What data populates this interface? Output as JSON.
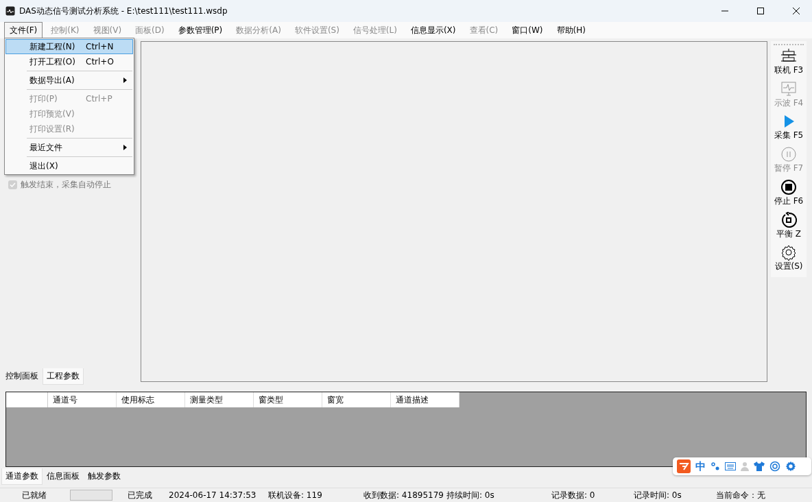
{
  "window": {
    "title": "DAS动态信号测试分析系统 - E:\\test111\\test111.wsdp"
  },
  "menu_bar": [
    {
      "label": "文件(F)",
      "disabled": false,
      "selected": true
    },
    {
      "label": "控制(K)",
      "disabled": true,
      "selected": false
    },
    {
      "label": "视图(V)",
      "disabled": true,
      "selected": false
    },
    {
      "label": "面板(D)",
      "disabled": true,
      "selected": false
    },
    {
      "label": "参数管理(P)",
      "disabled": false,
      "selected": false
    },
    {
      "label": "数据分析(A)",
      "disabled": true,
      "selected": false
    },
    {
      "label": "软件设置(S)",
      "disabled": true,
      "selected": false
    },
    {
      "label": "信号处理(L)",
      "disabled": true,
      "selected": false
    },
    {
      "label": "信息显示(X)",
      "disabled": false,
      "selected": false
    },
    {
      "label": "查看(C)",
      "disabled": true,
      "selected": false
    },
    {
      "label": "窗口(W)",
      "disabled": false,
      "selected": false
    },
    {
      "label": "帮助(H)",
      "disabled": false,
      "selected": false
    }
  ],
  "file_menu": [
    {
      "kind": "item",
      "label": "新建工程(N)",
      "shortcut": "Ctrl+N",
      "disabled": false,
      "selected": true
    },
    {
      "kind": "item",
      "label": "打开工程(O)",
      "shortcut": "Ctrl+O",
      "disabled": false,
      "selected": false
    },
    {
      "kind": "separator"
    },
    {
      "kind": "submenu",
      "label": "数据导出(A)",
      "disabled": false,
      "selected": false
    },
    {
      "kind": "separator"
    },
    {
      "kind": "item",
      "label": "打印(P)",
      "shortcut": "Ctrl+P",
      "disabled": true,
      "selected": false
    },
    {
      "kind": "item",
      "label": "打印预览(V)",
      "disabled": true,
      "selected": false
    },
    {
      "kind": "item",
      "label": "打印设置(R)",
      "disabled": true,
      "selected": false
    },
    {
      "kind": "separator"
    },
    {
      "kind": "submenu",
      "label": "最近文件",
      "disabled": false,
      "selected": false
    },
    {
      "kind": "separator"
    },
    {
      "kind": "item",
      "label": "退出(X)",
      "disabled": false,
      "selected": false
    }
  ],
  "left_panel": {
    "checkbox": {
      "label": "触发结束，采集自动停止",
      "checked": true,
      "disabled": true
    },
    "tabs": [
      {
        "label": "控制面板",
        "selected": false
      },
      {
        "label": "工程参数",
        "selected": true
      }
    ]
  },
  "right_toolbar": [
    {
      "kind": "connect",
      "label": "联机 F3",
      "disabled": false
    },
    {
      "kind": "scope",
      "label": "示波 F4",
      "disabled": true
    },
    {
      "kind": "play",
      "label": "采集 F5",
      "disabled": false
    },
    {
      "kind": "pause",
      "label": "暂停 F7",
      "disabled": true
    },
    {
      "kind": "stop",
      "label": "停止 F6",
      "disabled": false
    },
    {
      "kind": "balance",
      "label": "平衡 Z",
      "disabled": false
    },
    {
      "kind": "settings",
      "label": "设置(S)",
      "disabled": false
    }
  ],
  "channel_table": {
    "columns": [
      "通道号",
      "使用标志",
      "测量类型",
      "窗类型",
      "窗宽",
      "通道描述"
    ]
  },
  "bottom_tabs": [
    {
      "label": "通道参数",
      "selected": true
    },
    {
      "label": "信息面板",
      "selected": false
    },
    {
      "label": "触发参数",
      "selected": false
    }
  ],
  "ime_toolbar": {
    "mode": "中"
  },
  "status_bar": {
    "state": "已就绪",
    "progress": {
      "level": 0
    },
    "items": [
      "已完成",
      "2024-06-17 14:37:53",
      "联机设备: 119",
      "收到数据: 41895179",
      "持续时间: 0s",
      "记录数据: 0",
      "记录时间: 0s",
      "当前命令：无"
    ]
  }
}
